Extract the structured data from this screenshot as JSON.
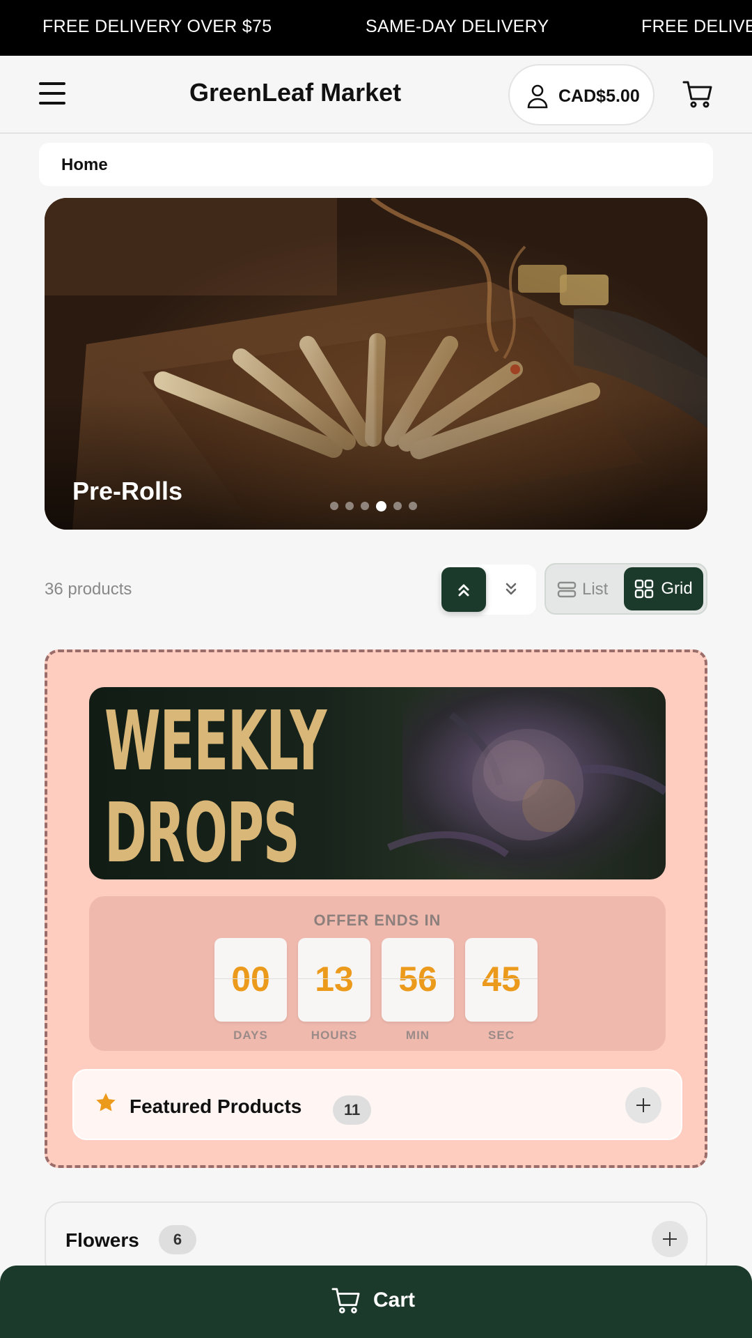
{
  "ticker": {
    "items": [
      "FREE DELIVERY OVER $75",
      "SAME-DAY DELIVERY",
      "FREE DELIVE"
    ]
  },
  "header": {
    "brand": "GreenLeaf Market",
    "account_balance": "CAD$5.00"
  },
  "breadcrumb": {
    "current": "Home"
  },
  "hero": {
    "title": "Pre-Rolls",
    "slide_count": 6,
    "active_slide": 4
  },
  "toolbar": {
    "product_count": "36 products",
    "view_list_label": "List",
    "view_grid_label": "Grid",
    "active_view": "Grid"
  },
  "promo": {
    "banner_line1": "WEEKLY",
    "banner_line2": "DROPS",
    "countdown_label": "OFFER ENDS IN",
    "countdown": [
      {
        "value": "00",
        "unit": "DAYS"
      },
      {
        "value": "13",
        "unit": "HOURS"
      },
      {
        "value": "56",
        "unit": "MIN"
      },
      {
        "value": "45",
        "unit": "SEC"
      }
    ],
    "featured_label": "Featured Products",
    "featured_count": "11"
  },
  "categories": [
    {
      "label": "Flowers",
      "count": "6"
    }
  ],
  "cart_bar": {
    "label": "Cart"
  },
  "colors": {
    "brand_green": "#1c3a2b",
    "promo_background": "#ffccc0",
    "countdown_digits": "#ec9a1c",
    "star": "#ec9a1c"
  }
}
